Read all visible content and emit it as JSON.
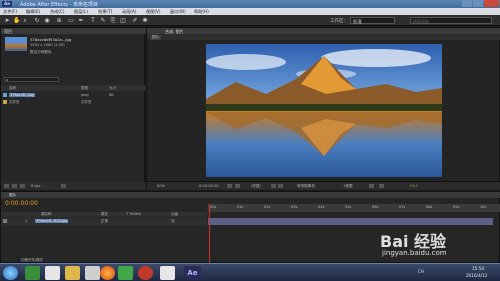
{
  "window": {
    "title": "Adobe After Effects - 未命名项目",
    "app_icon": "Ae"
  },
  "menu": [
    "文件(F)",
    "编辑(E)",
    "合成(C)",
    "图层(L)",
    "效果(T)",
    "动画(A)",
    "视图(V)",
    "窗口(W)",
    "帮助(H)"
  ],
  "toolbar": {
    "workspace_label": "工作区:",
    "workspace_value": "标准",
    "search_placeholder": "搜索帮助"
  },
  "project_panel": {
    "tab": "项目",
    "file_name": "378acc8df53a2a...jpg",
    "file_info": "1920 x 1080 (1.00)",
    "file_sub": "数百万种颜色",
    "search_placeholder": "ρ",
    "col_name": "名称",
    "col_type": "类型",
    "col_size": "大小",
    "items": [
      {
        "name": "378acc8...jpg",
        "type": "Jpeg",
        "size": "KB"
      },
      {
        "name": "文件夹",
        "type": "文件夹",
        "size": ""
      }
    ],
    "bpc": "8 bpc"
  },
  "comp_panel": {
    "tab": "合成: 图片",
    "subtab": "图片",
    "zoom": "50%",
    "timecode": "0:00:00:00",
    "resolution": "(完整)",
    "camera": "有效摄像机",
    "views": "1视图",
    "exposure": "+0.0"
  },
  "timeline": {
    "tab": "图片",
    "timecode": "0:00:00:00",
    "col_source": "源名称",
    "col_mode": "模式",
    "col_trkmat": "T TrkMat",
    "col_parent": "父级",
    "layer_num": "1",
    "layer_name": "378acc8...820.jpg",
    "layer_mode": "正常",
    "layer_parent": "无",
    "ticks": [
      "00s",
      "01s",
      "02s",
      "03s",
      "04s",
      "05s",
      "06s",
      "07s",
      "08s",
      "09s",
      "10s"
    ],
    "footer": "切换开关/模式"
  },
  "taskbar": {
    "time": "15:54",
    "date": "2016/4/12",
    "lang": "CH"
  },
  "watermark": {
    "brand": "Bai 经验",
    "url": "jingyan.baidu.com"
  }
}
